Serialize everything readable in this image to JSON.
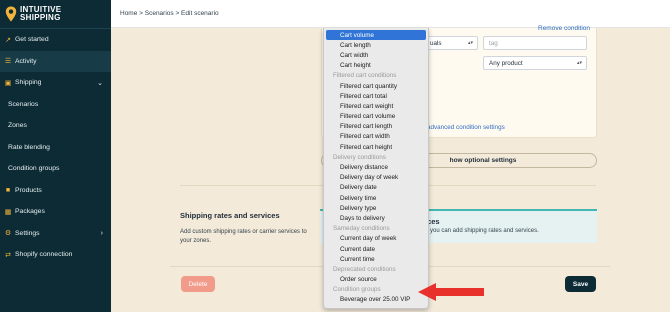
{
  "brand": {
    "name_line1": "INTUITIVE",
    "name_line2": "SHIPPING",
    "accent": "#f2b43a",
    "sidebar_bg": "#0c2b35"
  },
  "breadcrumb": "Home > Scenarios > Edit scenario",
  "sidebar": {
    "items": [
      {
        "label": "Get started",
        "icon": "rocket-icon"
      },
      {
        "label": "Activity",
        "icon": "activity-icon"
      },
      {
        "label": "Shipping",
        "icon": "truck-icon",
        "expanded": true
      },
      {
        "label": "Scenarios"
      },
      {
        "label": "Zones"
      },
      {
        "label": "Rate blending"
      },
      {
        "label": "Condition groups"
      },
      {
        "label": "Products",
        "icon": "box-icon"
      },
      {
        "label": "Packages",
        "icon": "package-icon"
      },
      {
        "label": "Settings",
        "icon": "gear-icon"
      },
      {
        "label": "Shopify connection",
        "icon": "link-icon"
      }
    ]
  },
  "condition": {
    "remove_link": "Remove condition",
    "operator_value": "uals",
    "tag_placeholder": "tag",
    "product_value": "Any product",
    "advanced_link": "advanced condition settings"
  },
  "optional_button": "how optional settings",
  "rates": {
    "title": "Shipping rates and services",
    "description": "Add custom shipping rates or carrier services to your zones.",
    "card_title": "ices",
    "card_description": "e you can add shipping rates and services."
  },
  "footer": {
    "delete_label": "Delete",
    "save_label": "Save"
  },
  "dropdown": {
    "rows": [
      {
        "label": "Cart volume",
        "type": "selected"
      },
      {
        "label": "Cart length",
        "type": "item"
      },
      {
        "label": "Cart width",
        "type": "item"
      },
      {
        "label": "Cart height",
        "type": "item"
      },
      {
        "label": "Filtered cart conditions",
        "type": "group"
      },
      {
        "label": "Filtered cart quantity",
        "type": "item"
      },
      {
        "label": "Filtered cart total",
        "type": "item"
      },
      {
        "label": "Filtered cart weight",
        "type": "item"
      },
      {
        "label": "Filtered cart volume",
        "type": "item"
      },
      {
        "label": "Filtered cart length",
        "type": "item"
      },
      {
        "label": "Filtered cart width",
        "type": "item"
      },
      {
        "label": "Filtered cart height",
        "type": "item"
      },
      {
        "label": "Delivery conditions",
        "type": "group"
      },
      {
        "label": "Delivery distance",
        "type": "item"
      },
      {
        "label": "Delivery day of week",
        "type": "item"
      },
      {
        "label": "Delivery date",
        "type": "item"
      },
      {
        "label": "Delivery time",
        "type": "item"
      },
      {
        "label": "Delivery type",
        "type": "item"
      },
      {
        "label": "Days to delivery",
        "type": "item"
      },
      {
        "label": "Sameday conditions",
        "type": "group"
      },
      {
        "label": "Current day of week",
        "type": "item"
      },
      {
        "label": "Current date",
        "type": "item"
      },
      {
        "label": "Current time",
        "type": "item"
      },
      {
        "label": "Deprecated conditions",
        "type": "group"
      },
      {
        "label": "Order source",
        "type": "item"
      },
      {
        "label": "Condition groups",
        "type": "group"
      },
      {
        "label": "Beverage over 25.00 VIP",
        "type": "item"
      }
    ]
  },
  "annotation": {
    "arrow_color": "#e8312a"
  }
}
